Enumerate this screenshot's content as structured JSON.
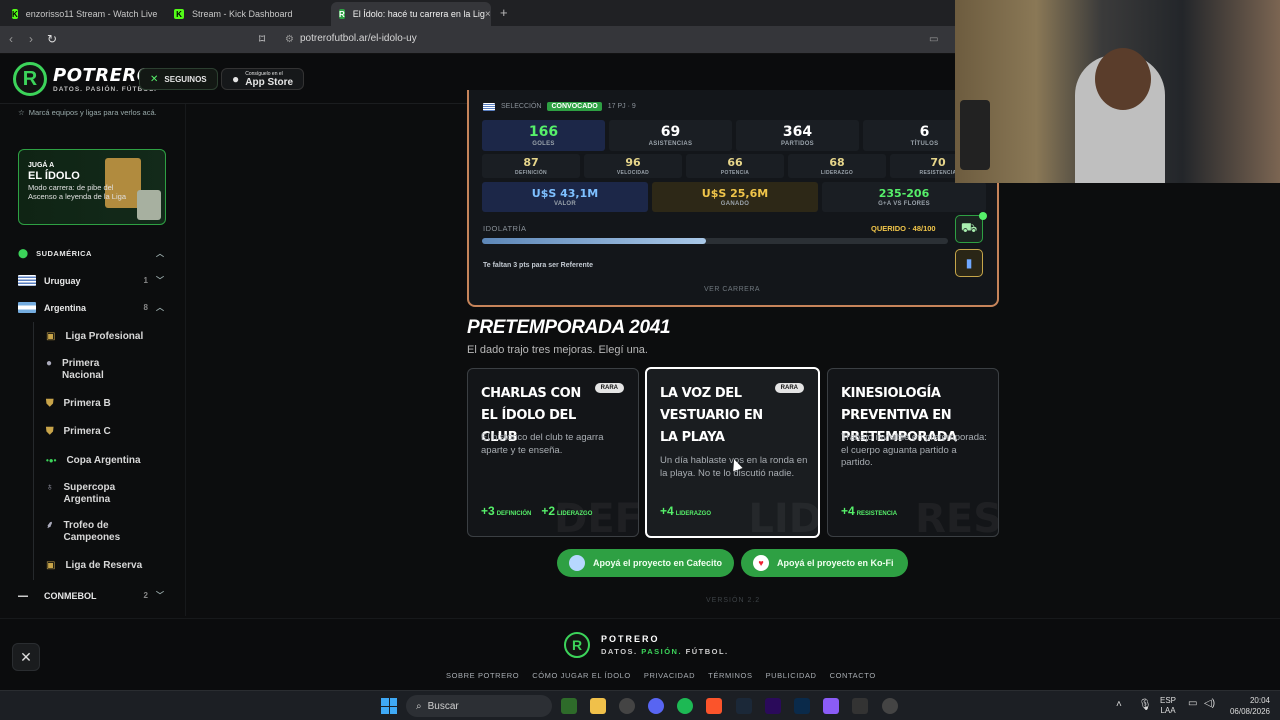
{
  "browser": {
    "tabs": [
      {
        "title": "enzorisso11 Stream - Watch Live"
      },
      {
        "title": "Stream - Kick Dashboard"
      },
      {
        "title": "El Ídolo: hacé tu carrera en la Lig"
      }
    ],
    "new_tab": "+",
    "url": "potrerofutbol.ar/el-idolo-uy",
    "close_tab": "×"
  },
  "header": {
    "logo_text": "POTRERO",
    "tagline": "DATOS. PASIÓN. FÚTBOL.",
    "follow_label": "SEGUINOS",
    "appstore_small": "Consíguelo en el",
    "appstore_big": "App Store"
  },
  "sidebar": {
    "hint": "Marcá equipos y ligas para verlos acá.",
    "promo": {
      "line1": "JUGÁ A",
      "line2": "EL ÍDOLO",
      "desc": "Modo carrera: de pibe del Ascenso a leyenda de la Liga"
    },
    "region": "SUDAMÉRICA",
    "countries": [
      {
        "name": "Uruguay",
        "count": "1"
      },
      {
        "name": "Argentina",
        "count": "8"
      }
    ],
    "leagues": [
      {
        "name": "Liga Profesional"
      },
      {
        "name": "Primera Nacional"
      },
      {
        "name": "Primera B"
      },
      {
        "name": "Primera C"
      },
      {
        "name": "Copa Argentina"
      },
      {
        "name": "Supercopa Argentina"
      },
      {
        "name": "Trofeo de Campeones"
      },
      {
        "name": "Liga de Reserva"
      }
    ],
    "conmebol": {
      "name": "CONMEBOL",
      "count": "2"
    }
  },
  "career_card": {
    "selection_label": "SELECCIÓN",
    "status": "CONVOCADO",
    "matches": "17 PJ · 9",
    "stats": [
      {
        "value": "166",
        "label": "GOLES"
      },
      {
        "value": "69",
        "label": "ASISTENCIAS"
      },
      {
        "value": "364",
        "label": "PARTIDOS"
      },
      {
        "value": "6",
        "label": "TÍTULOS"
      }
    ],
    "attributes": [
      {
        "value": "87",
        "label": "DEFINICIÓN"
      },
      {
        "value": "96",
        "label": "VELOCIDAD"
      },
      {
        "value": "66",
        "label": "POTENCIA"
      },
      {
        "value": "68",
        "label": "LIDERAZGO"
      },
      {
        "value": "70",
        "label": "RESISTENCIA"
      }
    ],
    "money": [
      {
        "value": "U$S 43,1M",
        "label": "VALOR"
      },
      {
        "value": "U$S 25,6M",
        "label": "GANADO"
      }
    ],
    "record": {
      "value": "235-206",
      "label": "G+A VS FLORES"
    },
    "idolatria_label": "IDOLATRÍA",
    "idolatria_status": "QUERIDO · 48/100",
    "idolatria_progress": 0.48,
    "hint": "Te faltan 3 pts para ser Referente",
    "view_career": "VER CARRERA"
  },
  "preseason": {
    "title": "PRETEMPORADA 2041",
    "subtitle": "El dado trajo tres mejoras. Elegí una.",
    "options": [
      {
        "title": "CHARLAS CON EL ÍDOLO DEL CLUB",
        "badge": "RARA",
        "desc": "El histórico del club te agarra aparte y te enseña.",
        "bonuses": [
          {
            "n": "+3",
            "l": "DEFINICIÓN"
          },
          {
            "n": "+2",
            "l": "LIDERAZGO"
          }
        ],
        "ghost": "DEF"
      },
      {
        "title": "LA VOZ DEL VESTUARIO EN LA PLAYA",
        "badge": "RARA",
        "desc": "Un día hablaste vos en la ronda en la playa. No te lo discutió nadie.",
        "bonuses": [
          {
            "n": "+4",
            "l": "LIDERAZGO"
          }
        ],
        "ghost": "LID"
      },
      {
        "title": "KINESIOLOGÍA PREVENTIVA EN PRETEMPORADA",
        "badge": "",
        "desc": "Trabajo invisible en pretemporada: el cuerpo aguanta partido a partido.",
        "bonuses": [
          {
            "n": "+4",
            "l": "RESISTENCIA"
          }
        ],
        "ghost": "RES"
      }
    ]
  },
  "donate": {
    "cafecito": "Apoyá el proyecto en Cafecito",
    "kofi": "Apoyá el proyecto en Ko-Fi"
  },
  "version": "VERSIÓN 2.2",
  "footer": {
    "logo": "POTRERO",
    "tagline_a": "DATOS.",
    "tagline_b": "PASIÓN.",
    "tagline_c": "FÚTBOL.",
    "links": [
      "SOBRE POTRERO",
      "CÓMO JUGAR EL ÍDOLO",
      "PRIVACIDAD",
      "TÉRMINOS",
      "PUBLICIDAD",
      "CONTACTO"
    ]
  },
  "taskbar": {
    "search": "Buscar",
    "lang1": "ESP",
    "lang2": "LAA",
    "time": "20:04",
    "date": "06/08/2026"
  }
}
